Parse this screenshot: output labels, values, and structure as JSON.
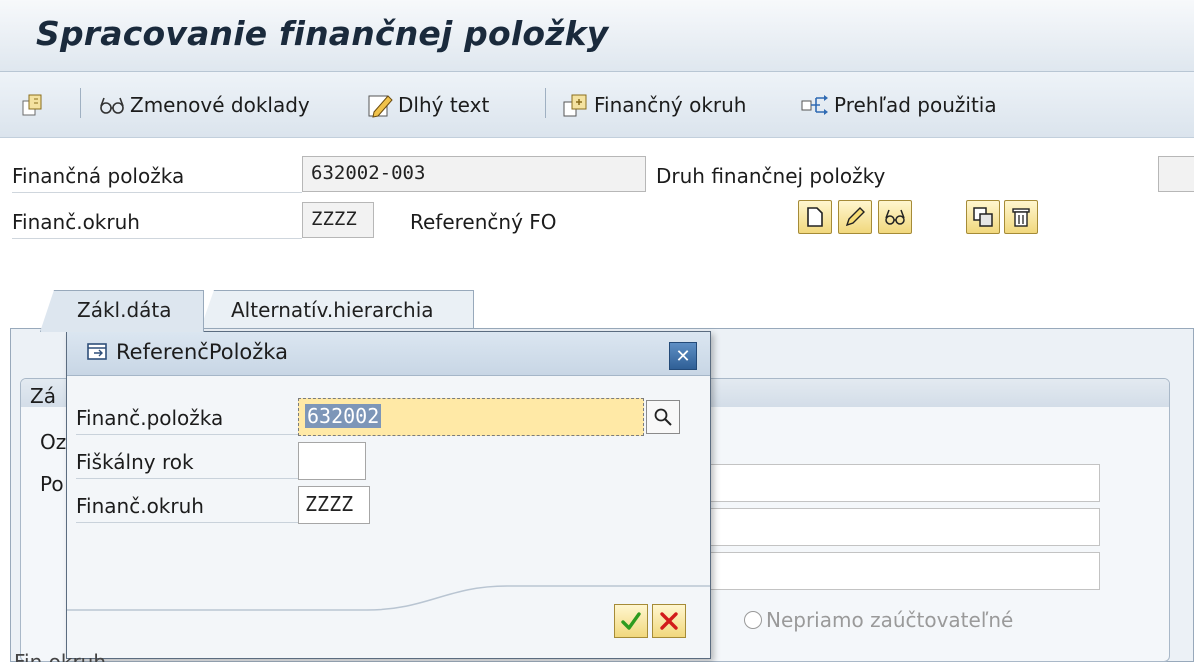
{
  "window": {
    "title": "Spracovanie finančnej položky"
  },
  "toolbar": {
    "change_docs": "Zmenové doklady",
    "long_text": "Dlhý text",
    "fin_area": "Finančný okruh",
    "usage": "Prehľad použitia"
  },
  "header": {
    "fin_item_label": "Finančná položka",
    "fin_item_value": "632002-003",
    "fin_item_type_label": "Druh finančnej položky",
    "fin_area_label": "Finanč.okruh",
    "fin_area_value": "ZZZZ",
    "ref_fo_label": "Referenčný FO"
  },
  "tabs": [
    {
      "label": "Zákl.dáta",
      "active": true
    },
    {
      "label": "Alternatív.hierarchia",
      "active": false
    }
  ],
  "background": {
    "group_title_partial": "Zá",
    "row1_partial": "Oz",
    "row2_partial": "Po",
    "radio_label": "Nepriamo zaúčtovateľné",
    "bottom_partial": "Fin.okruh"
  },
  "dialog": {
    "title": "ReferenčPoložka",
    "fields": [
      {
        "label": "Finanč.položka",
        "value": "632002"
      },
      {
        "label": "Fiškálny rok",
        "value": ""
      },
      {
        "label": "Finanč.okruh",
        "value": "ZZZZ"
      }
    ]
  },
  "colors": {
    "title_bar": "#dfe7ef",
    "button_yellow": "#f1d87d",
    "focused_field": "#ffe9a6",
    "close_button": "#2f5f96",
    "ok_green": "#2e9b1f",
    "cancel_red": "#d21b1b"
  },
  "icons": [
    "other-object-icon",
    "glasses-icon",
    "pencil-note-icon",
    "document-branch-icon",
    "arrow-branch-icon",
    "create-icon",
    "change-pencil-icon",
    "display-glasses-icon",
    "copy-icon",
    "delete-trash-icon",
    "window-icon",
    "close-icon",
    "search-icon",
    "checkmark-icon",
    "cancel-x-icon"
  ]
}
